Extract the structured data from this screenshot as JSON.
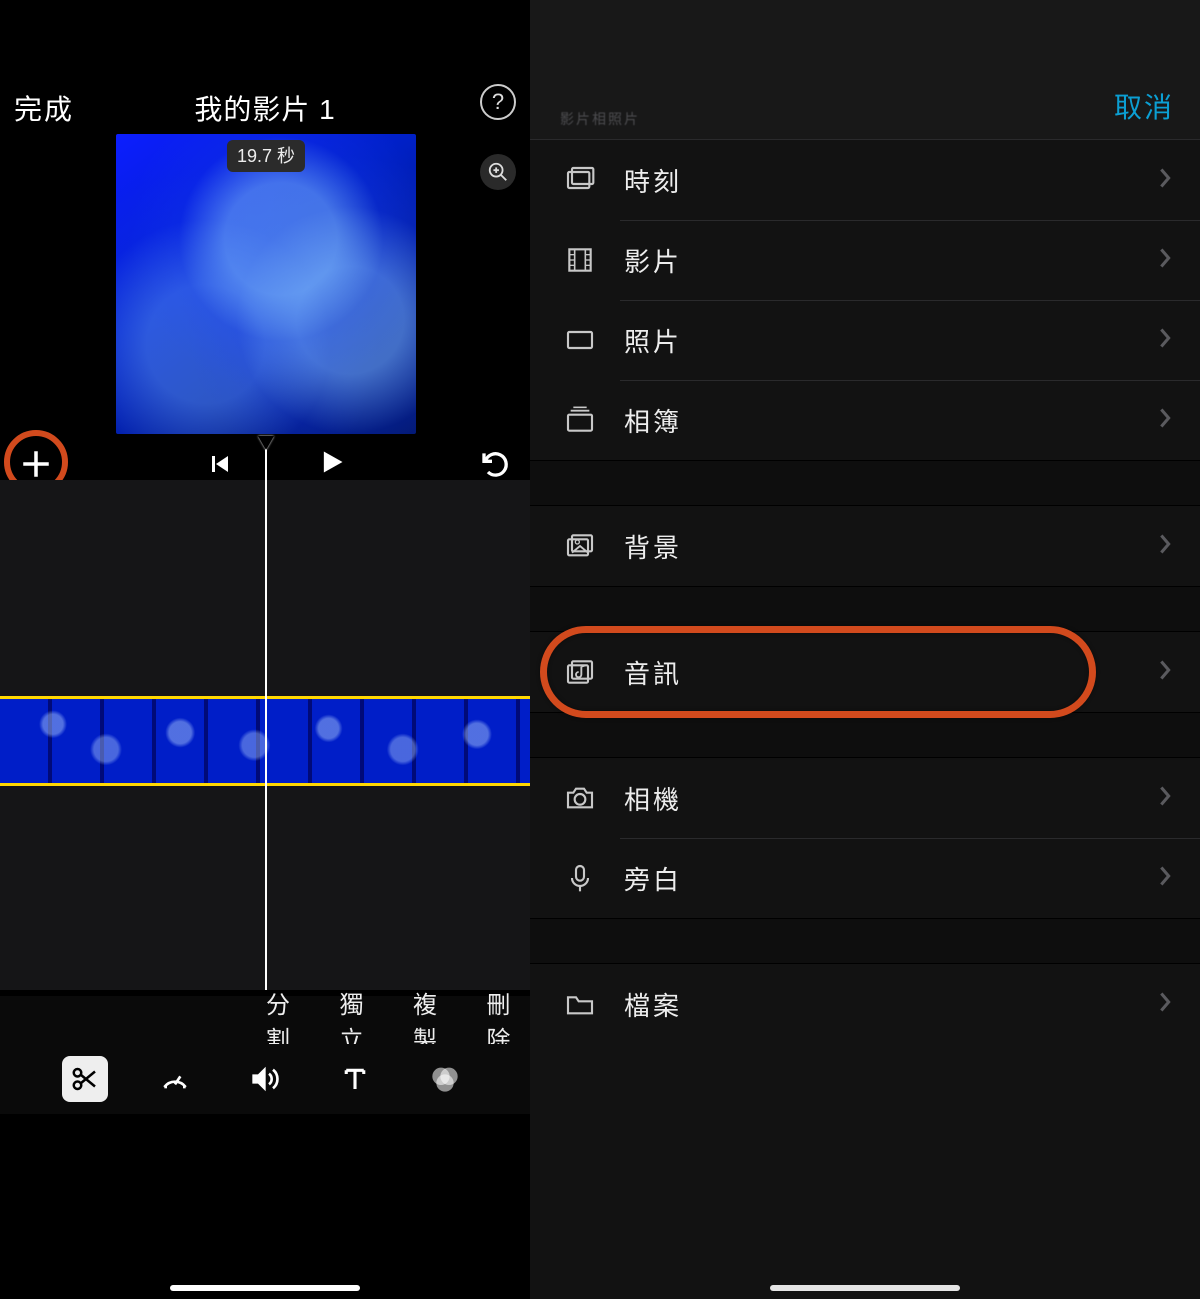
{
  "editor": {
    "done": "完成",
    "title": "我的影片 1",
    "clip_duration": "19.7 秒",
    "actions": {
      "split": "分割",
      "detach": "獨立",
      "duplicate": "複製",
      "delete": "刪除"
    }
  },
  "picker": {
    "cancel": "取消",
    "faint_header": "影片相照片",
    "sections": {
      "moments": "時刻",
      "videos": "影片",
      "photos": "照片",
      "albums": "相簿",
      "backgrounds": "背景",
      "audio": "音訊",
      "camera": "相機",
      "voiceover": "旁白",
      "files": "檔案"
    }
  },
  "icons": {
    "help": "?",
    "chevron": ">"
  }
}
